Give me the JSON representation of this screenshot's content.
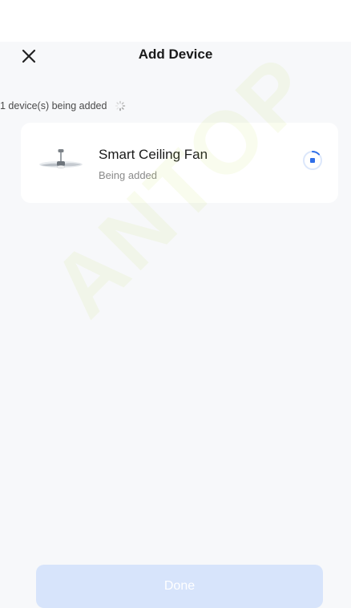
{
  "header": {
    "title": "Add Device",
    "close_icon": "close-icon"
  },
  "status": {
    "text": "1 device(s) being added"
  },
  "device": {
    "name": "Smart Ceiling Fan",
    "status": "Being added",
    "image_icon": "ceiling-fan-icon",
    "progress_icon": "progress-spinner-icon"
  },
  "footer": {
    "done_label": "Done"
  },
  "colors": {
    "accent": "#2f6ee8",
    "done_button_disabled": "#d7e4fb",
    "background": "#f7f8fa",
    "card": "#ffffff"
  },
  "watermark": {
    "text": "ANTOP"
  }
}
